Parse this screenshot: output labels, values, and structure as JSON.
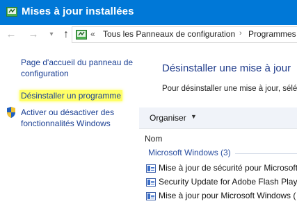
{
  "window": {
    "title": "Mises à jour installées"
  },
  "nav": {
    "back_icon": "arrow-left-icon",
    "forward_icon": "arrow-right-icon",
    "recent_icon": "chevron-down-icon",
    "up_icon": "arrow-up-icon",
    "chevron": "«",
    "breadcrumb": [
      "Tous les Panneaux de configuration",
      "Programmes"
    ],
    "separator": "›"
  },
  "sidebar": {
    "home_link": "Page d'accueil du panneau de configuration",
    "uninstall_link": "Désinstaller un programme",
    "features_link": "Activer ou désactiver des fonctionnalités Windows"
  },
  "main": {
    "heading": "Désinstaller une mise à jour",
    "description": "Pour désinstaller une mise à jour, sélé",
    "toolbar": {
      "organiser": "Organiser"
    },
    "column_header": "Nom",
    "group": {
      "label": "Microsoft Windows (3)"
    },
    "updates": [
      "Mise à jour de sécurité pour Microsoft",
      "Security Update for Adobe Flash Playe",
      "Mise à jour pour Microsoft Windows ("
    ]
  },
  "colors": {
    "titlebar": "#0078d7",
    "link": "#1a3f93",
    "highlight": "#ffff66"
  }
}
